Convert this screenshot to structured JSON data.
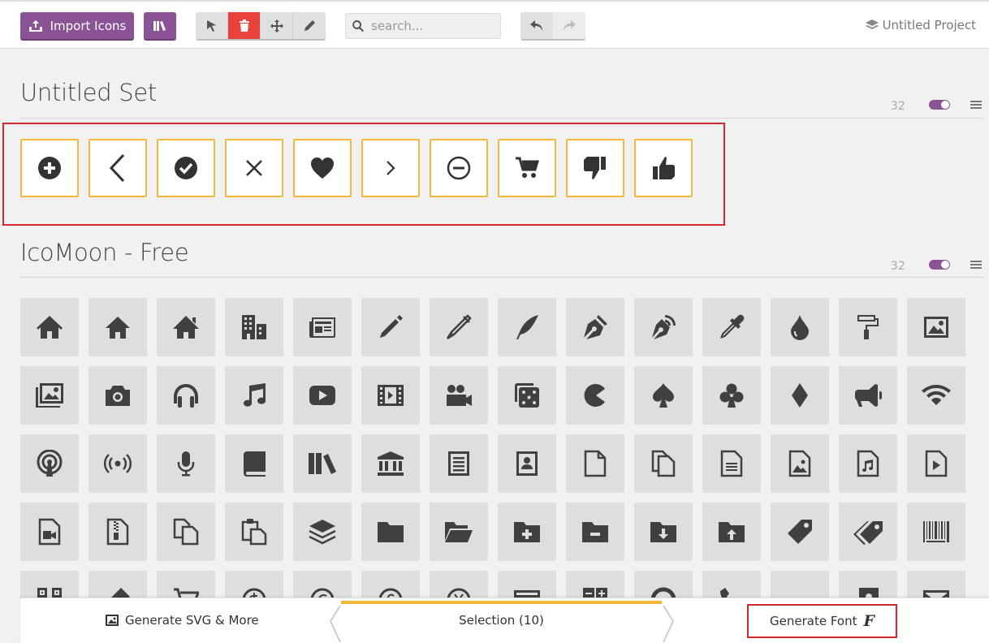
{
  "toolbar": {
    "import_label": "Import Icons",
    "search_placeholder": "search...",
    "project_name": "Untitled Project"
  },
  "sets": [
    {
      "title": "Untitled Set",
      "count": "32"
    },
    {
      "title": "IcoMoon - Free",
      "count": "32"
    }
  ],
  "selected_icons": [
    "plus-circle",
    "chevron-left",
    "check-circle",
    "cross",
    "heart",
    "chevron-right",
    "minus-circle",
    "cart",
    "thumbs-down",
    "thumbs-up"
  ],
  "free_icons": [
    [
      "home",
      "home2",
      "home3",
      "office",
      "newspaper",
      "pencil",
      "pencil2",
      "quill",
      "pen",
      "blog",
      "eyedropper",
      "droplet",
      "paint-format",
      "image"
    ],
    [
      "images",
      "camera",
      "headphones",
      "music",
      "play",
      "film",
      "video-camera",
      "dice",
      "pacman",
      "spades",
      "clubs",
      "diamonds",
      "bullhorn",
      "connection"
    ],
    [
      "podcast",
      "feed",
      "mic",
      "book",
      "books",
      "library",
      "file-text",
      "profile",
      "file-empty",
      "files-empty",
      "file-text2",
      "file-picture",
      "file-music",
      "file-play"
    ],
    [
      "file-video",
      "file-zip",
      "copy",
      "paste",
      "stack",
      "folder",
      "folder-open",
      "folder-plus",
      "folder-minus",
      "folder-download",
      "folder-upload",
      "price-tag",
      "price-tags",
      "barcode"
    ],
    [
      "qrcode",
      "ticket",
      "cart",
      "coin-dollar",
      "coin-euro",
      "coin-pound",
      "coin-yen",
      "credit-card",
      "calculator",
      "lifebuoy",
      "phone",
      "address-book",
      "envelop",
      "envelope"
    ]
  ],
  "footer": {
    "generate_svg": "Generate SVG & More",
    "selection": "Selection (10)",
    "generate_font": "Generate Font",
    "font_glyph": "F"
  }
}
